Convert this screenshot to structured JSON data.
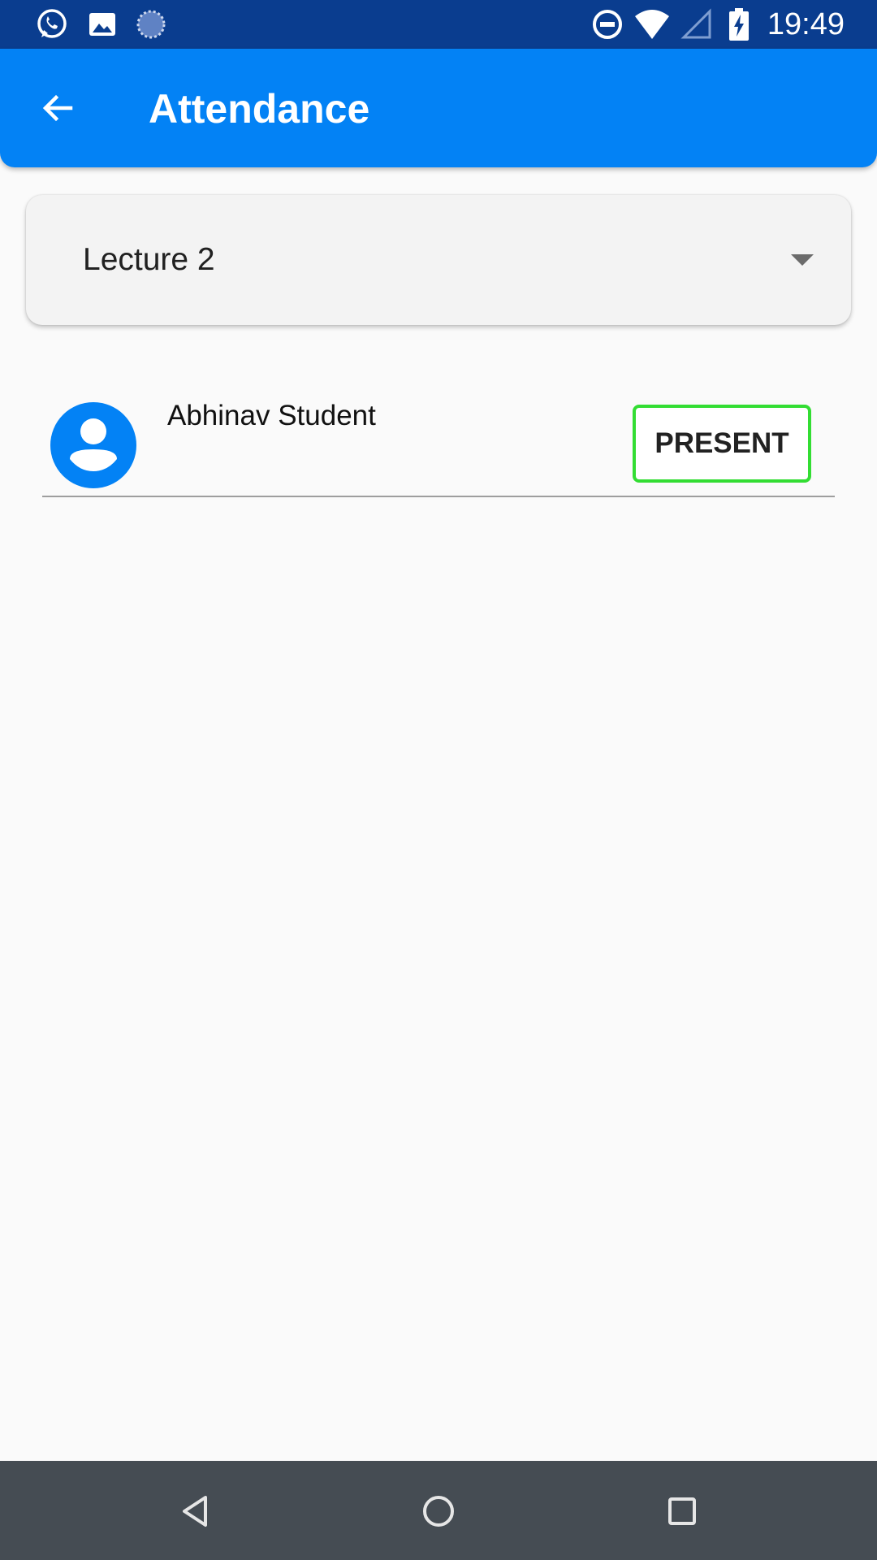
{
  "status_bar": {
    "time": "19:49",
    "left_icons": [
      "whatsapp-icon",
      "gallery-icon",
      "loader-icon"
    ],
    "right_icons": [
      "do-not-disturb-icon",
      "wifi-icon",
      "signal-icon",
      "battery-charging-icon"
    ]
  },
  "app_bar": {
    "title": "Attendance",
    "back_icon": "arrow-back-icon",
    "color": "#0382f5"
  },
  "lecture_select": {
    "selected": "Lecture 2"
  },
  "students": [
    {
      "name": "Abhinav Student",
      "status": "PRESENT",
      "status_color": "#33dd33"
    }
  ],
  "nav_bar": {
    "buttons": [
      "back-icon",
      "home-icon",
      "recents-icon"
    ]
  }
}
